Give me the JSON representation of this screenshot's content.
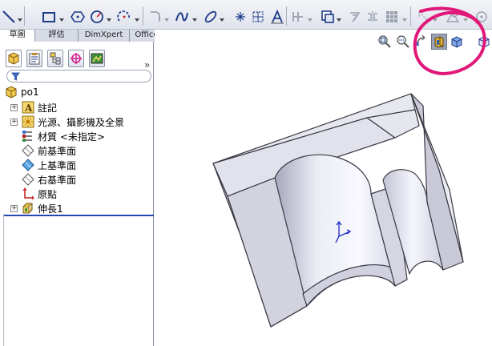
{
  "command_tabs": [
    "草圖",
    "評估",
    "DimXpert",
    "Office 產品"
  ],
  "tree": {
    "root": "po1",
    "items": [
      {
        "label": "註記",
        "icon": "annotations-icon",
        "expandable": true
      },
      {
        "label": "光源、攝影機及全景",
        "icon": "lights-cameras-icon",
        "expandable": true
      },
      {
        "label": "材質 <未指定>",
        "icon": "material-icon",
        "expandable": false
      },
      {
        "label": "前基準面",
        "icon": "plane-icon",
        "expandable": false
      },
      {
        "label": "上基準面",
        "icon": "plane-selected-icon",
        "expandable": false
      },
      {
        "label": "右基準面",
        "icon": "plane-icon",
        "expandable": false
      },
      {
        "label": "原點",
        "icon": "origin-icon",
        "expandable": false
      },
      {
        "label": "伸長1",
        "icon": "extrude-icon",
        "expandable": true
      }
    ]
  },
  "panel_tabs": [
    "featuremanager-tab",
    "propertymanager-tab",
    "configurationmanager-tab",
    "dimxpert-tab",
    "display-manager-tab"
  ],
  "colors": {
    "annotation_circle": "#e0187a",
    "part_face": "#e6e6f0",
    "part_edge": "#3a3a44",
    "axis": "#1b2bc4",
    "rollback_bar": "#2447b0"
  }
}
